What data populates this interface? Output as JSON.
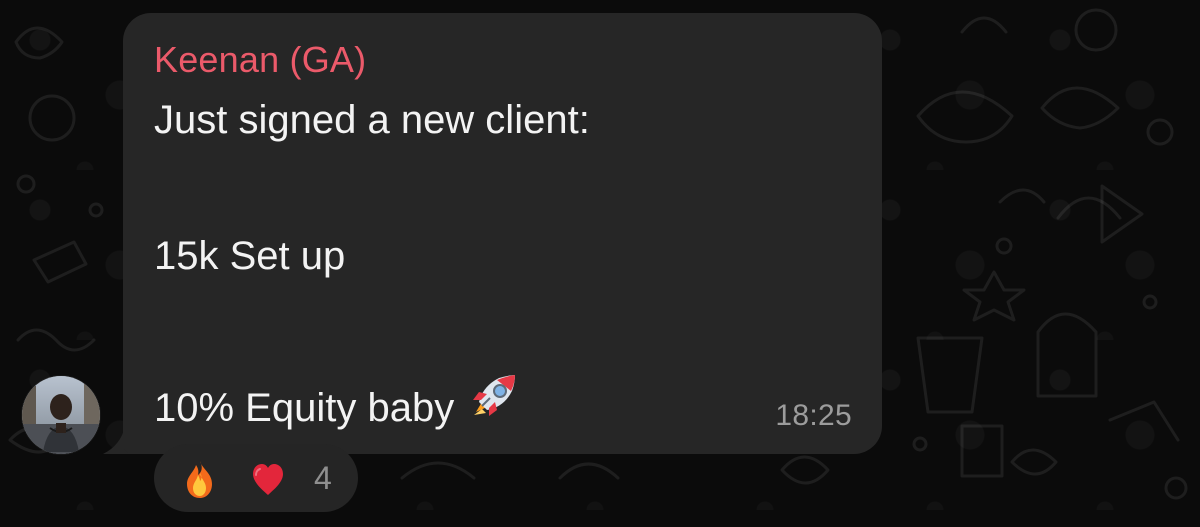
{
  "chat": {
    "background_color": "#0b0b0b"
  },
  "message": {
    "sender": "Keenan (GA)",
    "sender_color": "#eb5a6a",
    "lines": [
      "Just signed a new client:",
      "",
      "15k Set up",
      "",
      "10% Equity baby"
    ],
    "timestamp": "18:25",
    "bubble_color": "#262626"
  },
  "avatar": {
    "icon": "profile-photo"
  },
  "message_emoji": {
    "icon": "rocket-emoji"
  },
  "reactions": {
    "items": [
      {
        "icon": "fire-emoji"
      },
      {
        "icon": "heart-emoji"
      }
    ],
    "count": "4"
  }
}
